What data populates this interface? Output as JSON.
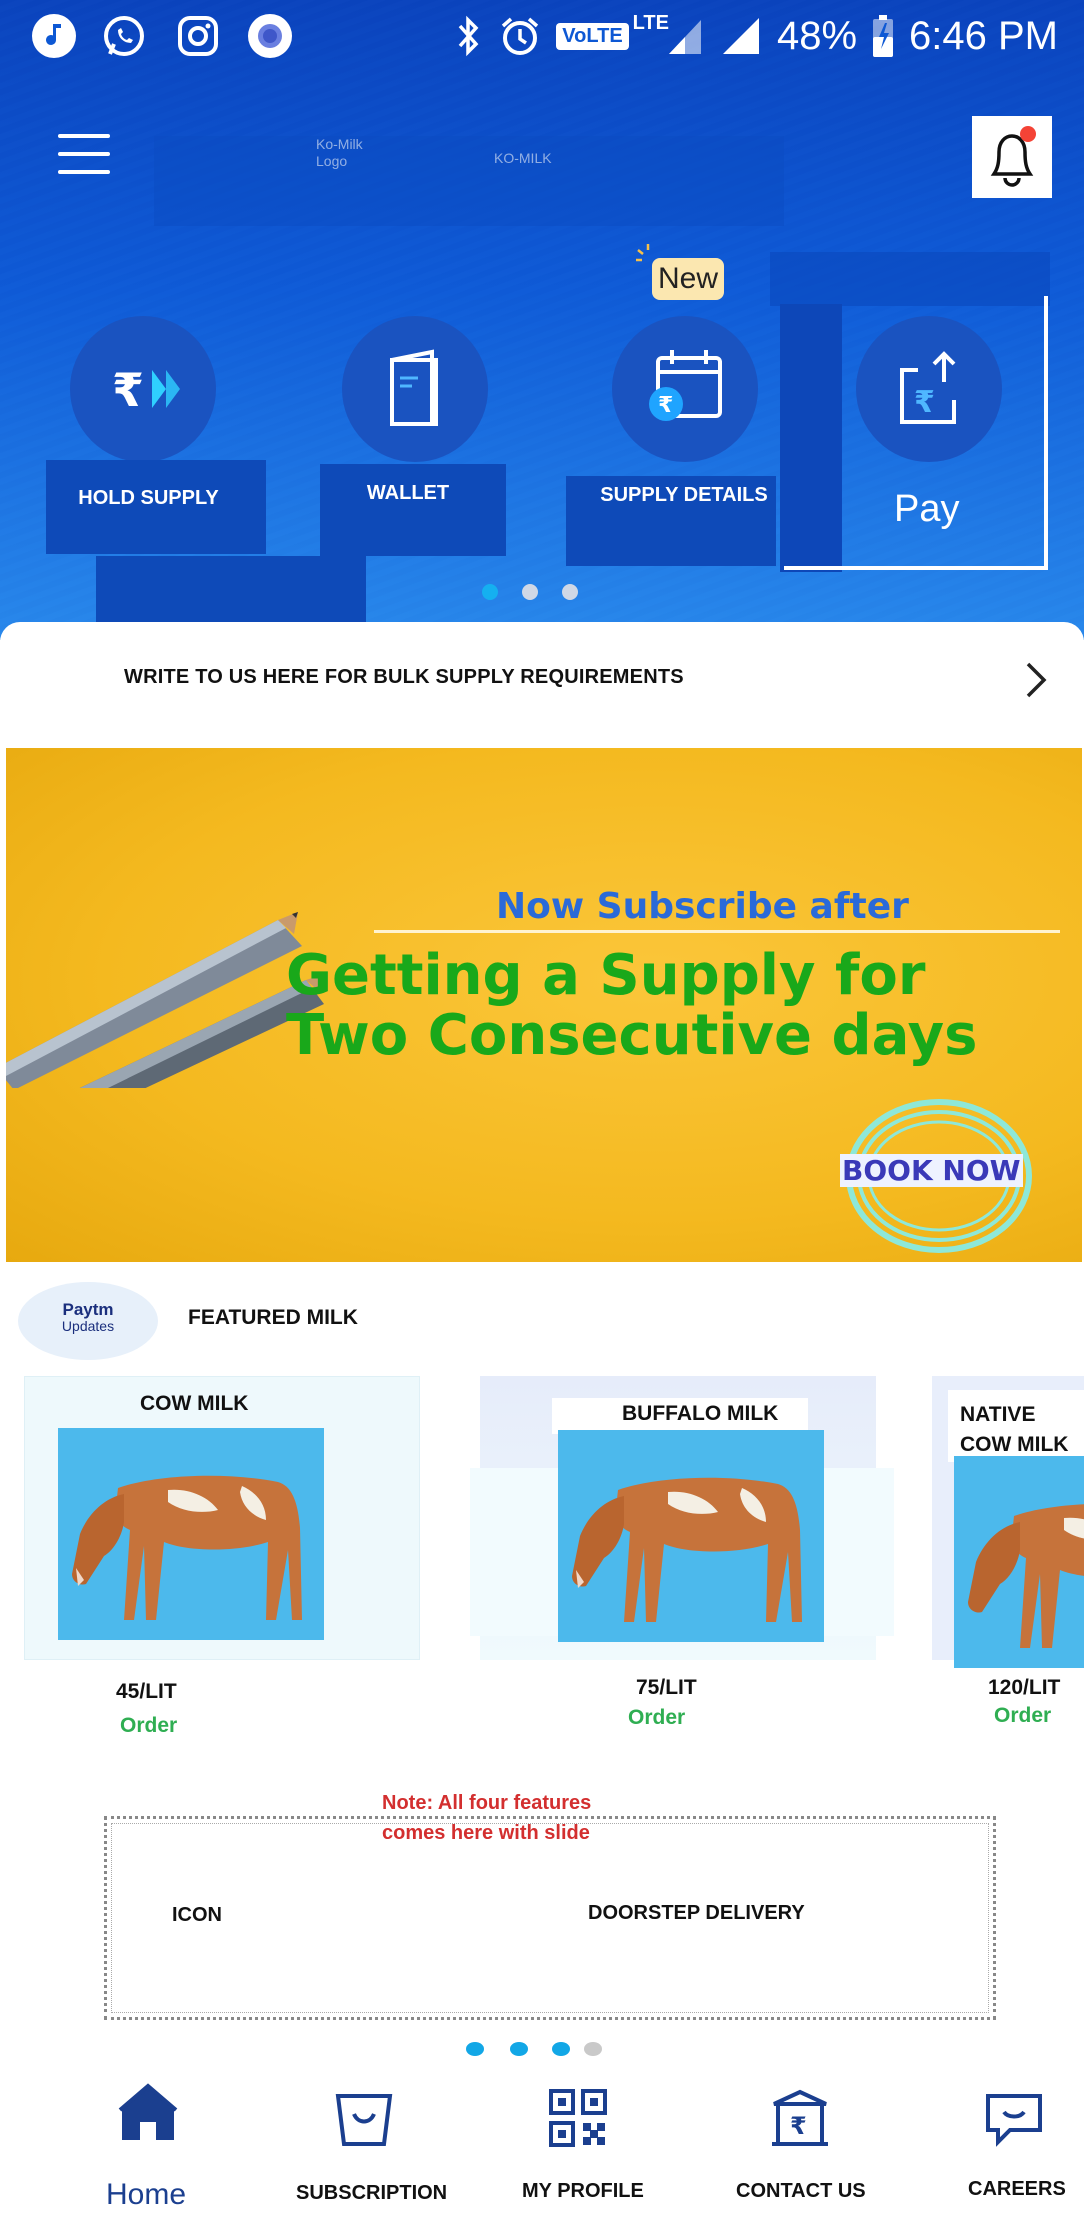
{
  "status_bar": {
    "network": "VoLTE",
    "signal_label": "LTE",
    "battery": "48%",
    "time": "6:46 PM"
  },
  "header": {
    "logo_text": "Ko-Milk Logo",
    "brand_text": "KO-MILK",
    "new_badge": "New"
  },
  "actions": [
    {
      "label": "HOLD SUPPLY",
      "icon": "rupee-forward-icon"
    },
    {
      "label": "WALLET",
      "icon": "wallet-icon"
    },
    {
      "label": "SUPPLY DETAILS",
      "icon": "calendar-rupee-icon"
    },
    {
      "label": "Pay",
      "icon": "rupee-upload-icon"
    }
  ],
  "hero_pager": {
    "count": 3,
    "active": 0
  },
  "bulk": {
    "text": "WRITE TO US HERE FOR BULK SUPPLY REQUIREMENTS"
  },
  "banner": {
    "subtitle": "Now Subscribe after",
    "title_line1": "Getting a Supply for",
    "title_line2": "Two Consecutive days",
    "cta": "BOOK NOW"
  },
  "featured": {
    "logo_line1": "Paytm",
    "logo_line2": "Updates",
    "title": "FEATURED MILK"
  },
  "products": [
    {
      "name": "COW MILK",
      "price": "45/LIT",
      "order": "Order"
    },
    {
      "name": "BUFFALO MILK",
      "price": "75/LIT",
      "order": "Order"
    },
    {
      "name_line1": "NATIVE",
      "name_line2": "COW MILK",
      "price": "120/LIT",
      "order": "Order"
    }
  ],
  "note": {
    "line1": "Note: All four features",
    "line2": "comes here with slide"
  },
  "feature_slide": {
    "icon_label": "ICON",
    "text": "DOORSTEP DELIVERY"
  },
  "feature_pager": {
    "count": 4,
    "active": 2
  },
  "colors": {
    "brand_blue": "#0f5ad6",
    "accent_green": "#2fae52",
    "note_red": "#d32f2f",
    "dot_active": "#12a7e6",
    "dot_inactive": "#c9c9c9"
  },
  "nav": [
    {
      "label": "Home",
      "icon": "home-icon"
    },
    {
      "label": "SUBSCRIPTION",
      "icon": "basket-icon"
    },
    {
      "label": "MY PROFILE",
      "icon": "qr-code-icon"
    },
    {
      "label": "CONTACT US",
      "icon": "bank-rupee-icon"
    },
    {
      "label": "CAREERS",
      "icon": "chat-icon"
    }
  ]
}
